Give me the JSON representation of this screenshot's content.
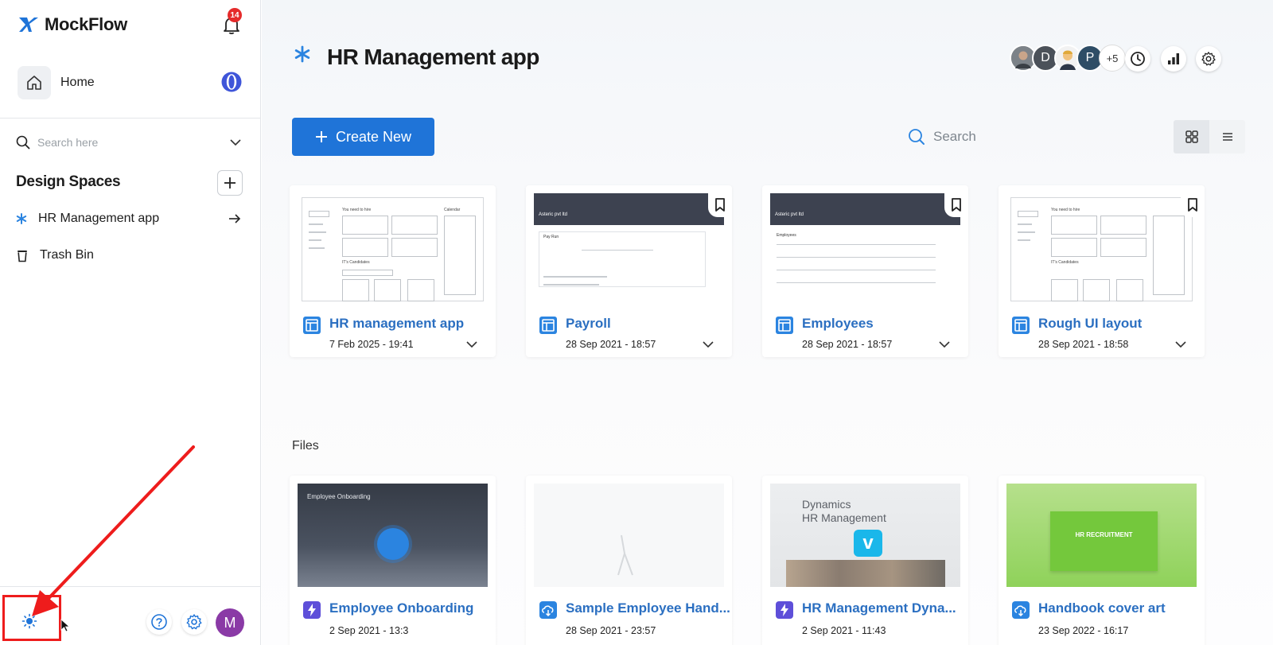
{
  "app": {
    "name": "MockFlow",
    "notifications_count": "14"
  },
  "sidebar": {
    "home_label": "Home",
    "search_placeholder": "Search here",
    "design_spaces_title": "Design Spaces",
    "items": [
      {
        "label": "HR Management app",
        "icon": "asterisk-icon"
      },
      {
        "label": "Trash Bin",
        "icon": "trash-icon"
      }
    ],
    "user_initial": "M"
  },
  "main": {
    "title": "HR Management app",
    "collaborators": [
      {
        "initial": "",
        "color": "#8a8f95",
        "kind": "photo"
      },
      {
        "initial": "D",
        "color": "#4b5159",
        "kind": "letter"
      },
      {
        "initial": "",
        "color": "#e8b84a",
        "kind": "emoji"
      },
      {
        "initial": "P",
        "color": "#2e4d66",
        "kind": "letter"
      }
    ],
    "collaborators_more": "+5",
    "create_label": "Create New",
    "search_placeholder": "Search",
    "view_mode": "grid",
    "projects": [
      {
        "title": "HR management app",
        "date": "7 Feb 2025 - 19:41"
      },
      {
        "title": "Payroll",
        "date": "28 Sep 2021 - 18:57"
      },
      {
        "title": "Employees",
        "date": "28 Sep 2021 - 18:57"
      },
      {
        "title": "Rough UI layout",
        "date": "28 Sep 2021 - 18:58"
      }
    ],
    "files_title": "Files",
    "files": [
      {
        "title": "Employee Onboarding",
        "date": "2 Sep 2021 - 13:3",
        "icon": "bolt-icon",
        "thumb_text": "Employee Onboarding"
      },
      {
        "title": "Sample Employee Hand...",
        "date": "28 Sep 2021 - 23:57",
        "icon": "cloud-download-icon",
        "thumb_text": ""
      },
      {
        "title": "HR Management Dyna...",
        "date": "2 Sep 2021 - 11:43",
        "icon": "bolt-icon",
        "thumb_text": "Dynamics HR Management"
      },
      {
        "title": "Handbook cover art",
        "date": "23 Sep 2022 - 16:17",
        "icon": "cloud-download-icon",
        "thumb_text": "HR RECRUITMENT"
      }
    ]
  },
  "thumbnails": {
    "wire_header_1": "You need to hire",
    "wire_header_2": "Calendar",
    "wire_sub": "IT's Candidates",
    "payroll_bar": "Asteric pvt ltd",
    "payroll_label": "Pay Run",
    "employees_bar": "Asteric pvt ltd",
    "employees_label": "Employees",
    "dynamics_line1": "Dynamics",
    "dynamics_line2": "HR Management"
  },
  "colors": {
    "accent": "#1f74d8",
    "link": "#2b6fc1",
    "annotation": "#ee1c1c",
    "avatar": "#8a3aa6"
  }
}
